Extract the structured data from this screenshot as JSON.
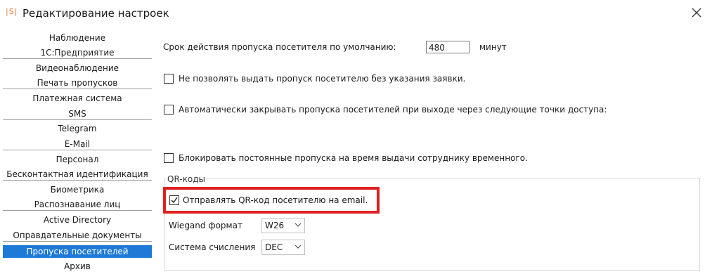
{
  "window": {
    "app_icon": "|S|",
    "title": "Редактирование настроек",
    "close_icon": "close-icon"
  },
  "sidebar": {
    "items": [
      {
        "label": "Наблюдение"
      },
      {
        "label": "1С:Предприятие"
      },
      {
        "label": "Видеонаблюдение"
      },
      {
        "label": "Печать пропусков"
      },
      {
        "label": "Платежная система"
      },
      {
        "label": "SMS"
      },
      {
        "label": "Telegram"
      },
      {
        "label": "E-Mail"
      },
      {
        "label": "Персонал"
      },
      {
        "label": "Бесконтактная идентификация"
      },
      {
        "label": "Биометрика"
      },
      {
        "label": "Распознавание лиц"
      },
      {
        "label": "Active Directory"
      },
      {
        "label": "Оправдательные документы"
      },
      {
        "label": "Пропуска посетителей",
        "active": true
      },
      {
        "label": "Архив"
      }
    ],
    "active_color": "#1e7ad6"
  },
  "content": {
    "pass_duration": {
      "label": "Срок действия пропуска посетителя по умолчанию:",
      "value": "480",
      "unit": "минут"
    },
    "options": [
      {
        "label": "Не позволять выдать пропуск посетителю без указания заявки.",
        "checked": false
      },
      {
        "label": "Автоматически закрывать пропуска посетителей при выходе через следующие точки доступа:",
        "checked": false
      },
      {
        "label": "Блокировать постоянные пропуска на время выдачи сотруднику временного.",
        "checked": false
      }
    ],
    "qr": {
      "group_title": "QR-коды",
      "send_email": {
        "label": "Отправлять QR-код посетителю на email.",
        "checked": true
      },
      "wiegand": {
        "label": "Wiegand формат",
        "value": "W26"
      },
      "number_system": {
        "label": "Система счисления",
        "value": "DEC"
      }
    },
    "highlight_color": "#e02020"
  }
}
